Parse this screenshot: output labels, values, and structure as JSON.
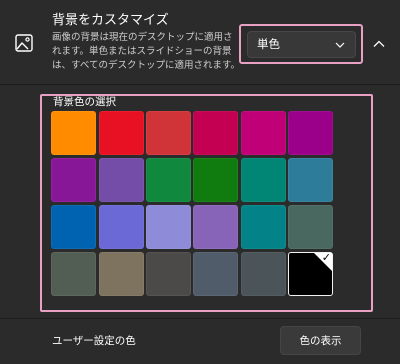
{
  "header": {
    "title": "背景をカスタマイズ",
    "description": "画像の背景は現在のデスクトップに適用されます。単色またはスライドショーの背景は、すべてのデスクトップに適用されます。",
    "icon": "image-icon",
    "dropdown": {
      "value": "単色",
      "icon": "chevron-down-icon"
    },
    "collapse_icon": "chevron-up-icon"
  },
  "color_picker": {
    "label": "背景色の選択",
    "selected_index": 23,
    "check_glyph": "✓",
    "swatches": [
      "#ff8c00",
      "#e81123",
      "#d13438",
      "#c30052",
      "#bf0077",
      "#9a0089",
      "#881798",
      "#744da9",
      "#10893e",
      "#107c10",
      "#018574",
      "#2d7d9a",
      "#0063b1",
      "#6b69d6",
      "#8e8cd8",
      "#8764b8",
      "#038387",
      "#486860",
      "#525e54",
      "#7e735f",
      "#4c4a48",
      "#515c6b",
      "#4a5459",
      "#000000"
    ]
  },
  "footer": {
    "custom_label": "ユーザー設定の色",
    "show_button": "色の表示"
  }
}
